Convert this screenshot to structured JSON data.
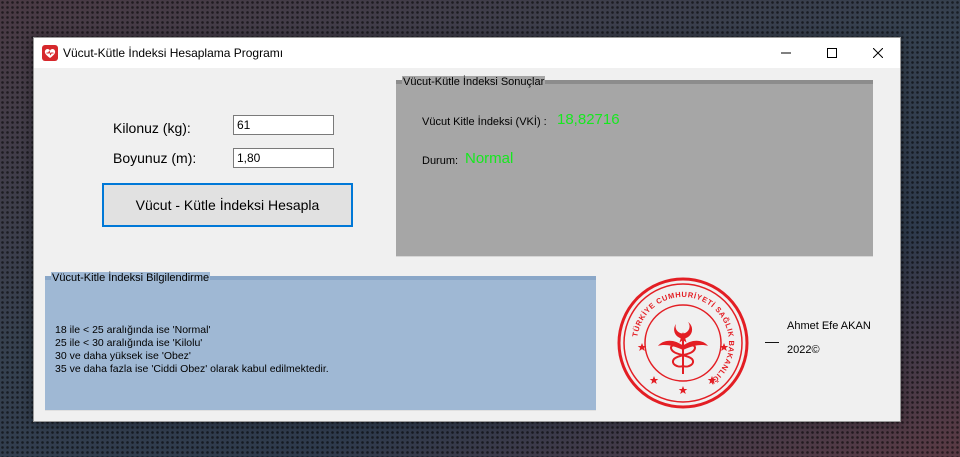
{
  "window": {
    "title": "Vücut-Kütle İndeksi Hesaplama Programı",
    "controls": {
      "minimize": "minimize",
      "maximize": "maximize",
      "close": "close"
    }
  },
  "form": {
    "weight_label": "Kilonuz (kg):",
    "weight_value": "61",
    "height_label": "Boyunuz (m):",
    "height_value": "1,80",
    "calculate_label": "Vücut - Kütle İndeksi Hesapla"
  },
  "results": {
    "caption": "Vücut-Kütle İndeksi Sonuçlar",
    "bmi_label": "Vücut Kitle İndeksi (VKİ) :",
    "bmi_value": "18,82716",
    "status_label": "Durum:",
    "status_value": "Normal",
    "value_color": "#16e81f"
  },
  "info": {
    "caption": "Vücut-Kitle İndeksi Bilgilendirme",
    "lines": [
      "18 ile < 25 aralığında ise 'Normal'",
      "25 ile < 30 aralığında ise 'Kilolu'",
      "30 ve daha yüksek ise 'Obez'",
      "35 ve daha fazla ise 'Ciddi Obez' olarak kabul edilmektedir."
    ]
  },
  "logo": {
    "icon": "ministry-seal-icon",
    "text": "TÜRKİYE CUMHURİYETİ SAĞLIK BAKANLIĞI",
    "color": "#e31e24"
  },
  "credits": {
    "dash": "—",
    "author": "Ahmet Efe AKAN",
    "year": "2022©"
  }
}
